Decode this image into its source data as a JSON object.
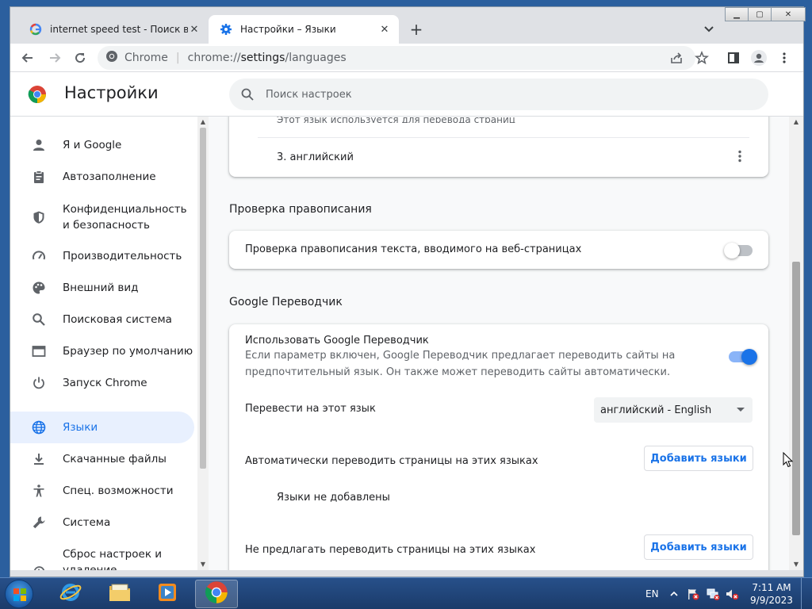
{
  "tabs": [
    {
      "title": "internet speed test - Поиск в Go",
      "icon": "google-g-icon"
    },
    {
      "title": "Настройки – Языки",
      "icon": "settings-gear-icon"
    }
  ],
  "toolbar": {
    "site_label": "Chrome",
    "url_prefix": "chrome://",
    "url_host": "settings",
    "url_path": "/languages"
  },
  "settings": {
    "title": "Настройки",
    "search_placeholder": "Поиск настроек"
  },
  "sidebar": {
    "items": [
      {
        "label": "Я и Google",
        "icon": "person-icon"
      },
      {
        "label": "Автозаполнение",
        "icon": "clipboard-icon"
      },
      {
        "label": "Конфиденциальность и безопасность",
        "icon": "shield-icon"
      },
      {
        "label": "Производительность",
        "icon": "speedometer-icon"
      },
      {
        "label": "Внешний вид",
        "icon": "palette-icon"
      },
      {
        "label": "Поисковая система",
        "icon": "search-icon"
      },
      {
        "label": "Браузер по умолчанию",
        "icon": "browser-window-icon"
      },
      {
        "label": "Запуск Chrome",
        "icon": "power-icon"
      },
      {
        "label": "Языки",
        "icon": "globe-icon"
      },
      {
        "label": "Скачанные файлы",
        "icon": "download-icon"
      },
      {
        "label": "Спец. возможности",
        "icon": "accessibility-icon"
      },
      {
        "label": "Система",
        "icon": "wrench-icon"
      },
      {
        "label": "Сброс настроек и удаление вредоносного",
        "icon": "history-icon"
      }
    ]
  },
  "languages": {
    "clipped_text": "Этот язык используется для перевода страниц",
    "item3": "3. английский"
  },
  "spellcheck": {
    "title": "Проверка правописания",
    "label": "Проверка правописания текста, вводимого на веб-страницах",
    "enabled": false
  },
  "translate": {
    "title": "Google Переводчик",
    "use_label": "Использовать Google Переводчик",
    "use_desc_line1": "Если параметр включен, Google Переводчик предлагает переводить сайты на",
    "use_desc_line2": "предпочтительный язык. Он также может переводить сайты автоматически.",
    "enabled": true,
    "target_label": "Перевести на этот язык",
    "target_value": "английский - English",
    "auto_label": "Автоматически переводить страницы на этих языках",
    "auto_button": "Добавить языки",
    "auto_empty": "Языки не добавлены",
    "never_label": "Не предлагать переводить страницы на этих языках",
    "never_button": "Добавить языки"
  },
  "taskbar": {
    "lang": "EN",
    "time": "7:11 AM",
    "date": "9/9/2023"
  },
  "colors": {
    "accent": "#1a73e8",
    "active_nav_bg": "#e8f0fe"
  }
}
